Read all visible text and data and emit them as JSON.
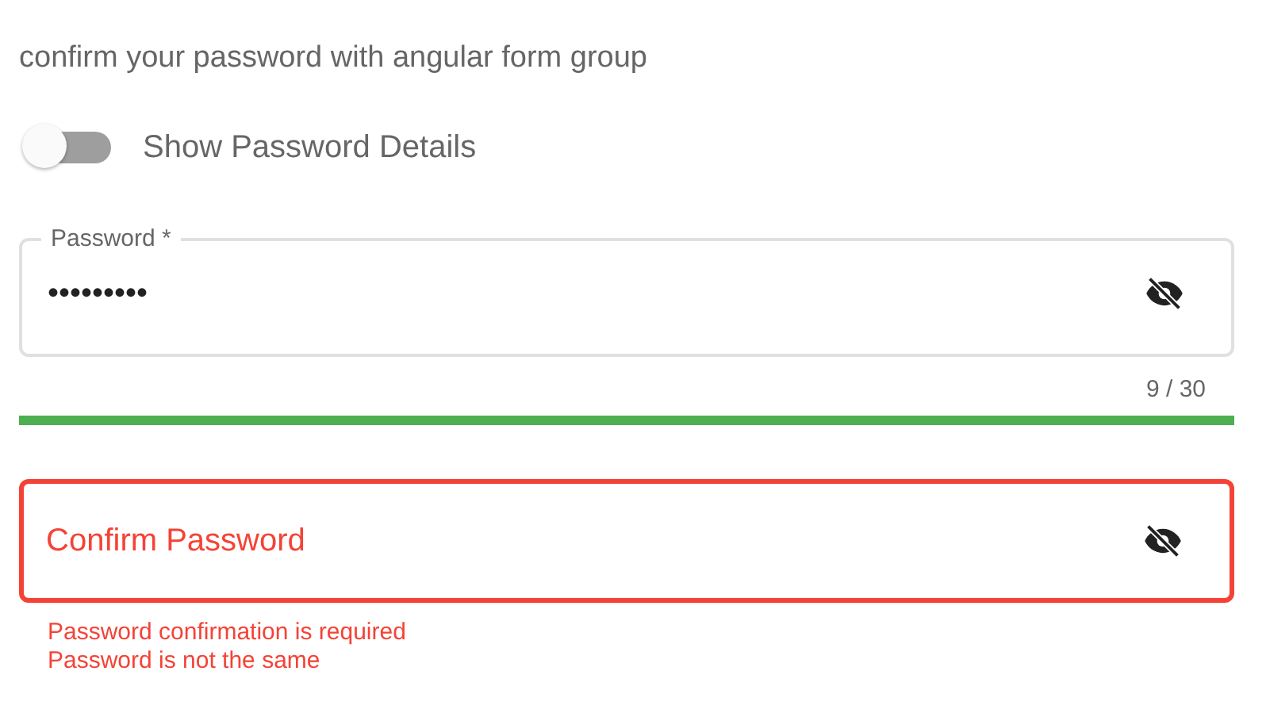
{
  "heading": "confirm your password with angular form group",
  "toggle": {
    "label": "Show Password Details",
    "on": false
  },
  "password": {
    "label": "Password *",
    "value": "•••••••••",
    "counter": "9 / 30",
    "invalid": false
  },
  "strength": {
    "level": 1,
    "color": "#4caf50"
  },
  "confirm": {
    "placeholder": "Confirm Password",
    "invalid": true,
    "errors": [
      "Password confirmation is required",
      "Password is not the same"
    ]
  }
}
